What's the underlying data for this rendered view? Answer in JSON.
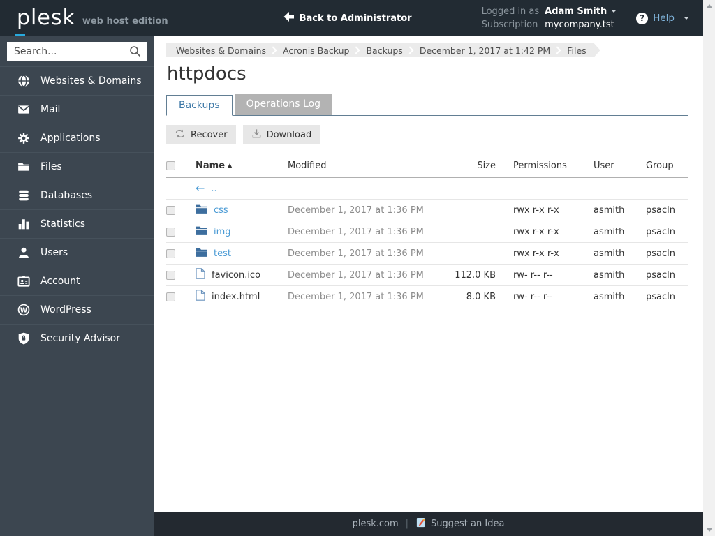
{
  "header": {
    "logo": "plesk",
    "logo_suffix": "web host edition",
    "back_label": "Back to Administrator",
    "logged_in_label": "Logged in as",
    "user_name": "Adam Smith",
    "subscription_label": "Subscription",
    "subscription_value": "mycompany.tst",
    "help_label": "Help"
  },
  "sidebar": {
    "search_placeholder": "Search...",
    "items": [
      {
        "icon": "globe-icon",
        "label": "Websites & Domains"
      },
      {
        "icon": "mail-icon",
        "label": "Mail"
      },
      {
        "icon": "gear-icon",
        "label": "Applications"
      },
      {
        "icon": "folder-icon",
        "label": "Files"
      },
      {
        "icon": "database-icon",
        "label": "Databases"
      },
      {
        "icon": "bar-chart-icon",
        "label": "Statistics"
      },
      {
        "icon": "user-icon",
        "label": "Users"
      },
      {
        "icon": "id-card-icon",
        "label": "Account"
      },
      {
        "icon": "wordpress-icon",
        "label": "WordPress"
      },
      {
        "icon": "shield-lock-icon",
        "label": "Security Advisor"
      }
    ]
  },
  "breadcrumb": {
    "items": [
      "Websites & Domains",
      "Acronis Backup",
      "Backups",
      "December 1, 2017 at 1:42 PM",
      "Files"
    ]
  },
  "page_title": "httpdocs",
  "tabs": {
    "items": [
      {
        "label": "Backups",
        "active": true
      },
      {
        "label": "Operations Log",
        "active": false
      }
    ]
  },
  "toolbar": {
    "recover_label": "Recover",
    "download_label": "Download"
  },
  "table": {
    "headers": {
      "name": "Name",
      "modified": "Modified",
      "size": "Size",
      "permissions": "Permissions",
      "user": "User",
      "group": "Group"
    },
    "sort_indicator": "▲",
    "up_arrow": "←",
    "up_label": "..",
    "rows": [
      {
        "type": "folder",
        "name": "css",
        "modified": "December 1, 2017 at 1:36 PM",
        "size": "",
        "permissions": "rwx r-x r-x",
        "user": "asmith",
        "group": "psacln"
      },
      {
        "type": "folder",
        "name": "img",
        "modified": "December 1, 2017 at 1:36 PM",
        "size": "",
        "permissions": "rwx r-x r-x",
        "user": "asmith",
        "group": "psacln"
      },
      {
        "type": "folder",
        "name": "test",
        "modified": "December 1, 2017 at 1:36 PM",
        "size": "",
        "permissions": "rwx r-x r-x",
        "user": "asmith",
        "group": "psacln"
      },
      {
        "type": "file",
        "name": "favicon.ico",
        "modified": "December 1, 2017 at 1:36 PM",
        "size": "112.0 KB",
        "permissions": "rw- r-- r--",
        "user": "asmith",
        "group": "psacln"
      },
      {
        "type": "file",
        "name": "index.html",
        "modified": "December 1, 2017 at 1:36 PM",
        "size": "8.0 KB",
        "permissions": "rw- r-- r--",
        "user": "asmith",
        "group": "psacln"
      }
    ]
  },
  "footer": {
    "link1": "plesk.com",
    "separator": "|",
    "link2": "Suggest an Idea"
  },
  "colors": {
    "topbar_bg": "#222b33",
    "sidebar_bg": "#3c4650",
    "footer_bg": "#232930",
    "accent_cyan": "#28aade",
    "link_blue": "#4b9bd5",
    "folder_blue": "#3d6e9e",
    "tab_active_text": "#3a76a5",
    "tab_inactive_bg": "#b3b3b3",
    "help_link": "#7fb3da"
  }
}
